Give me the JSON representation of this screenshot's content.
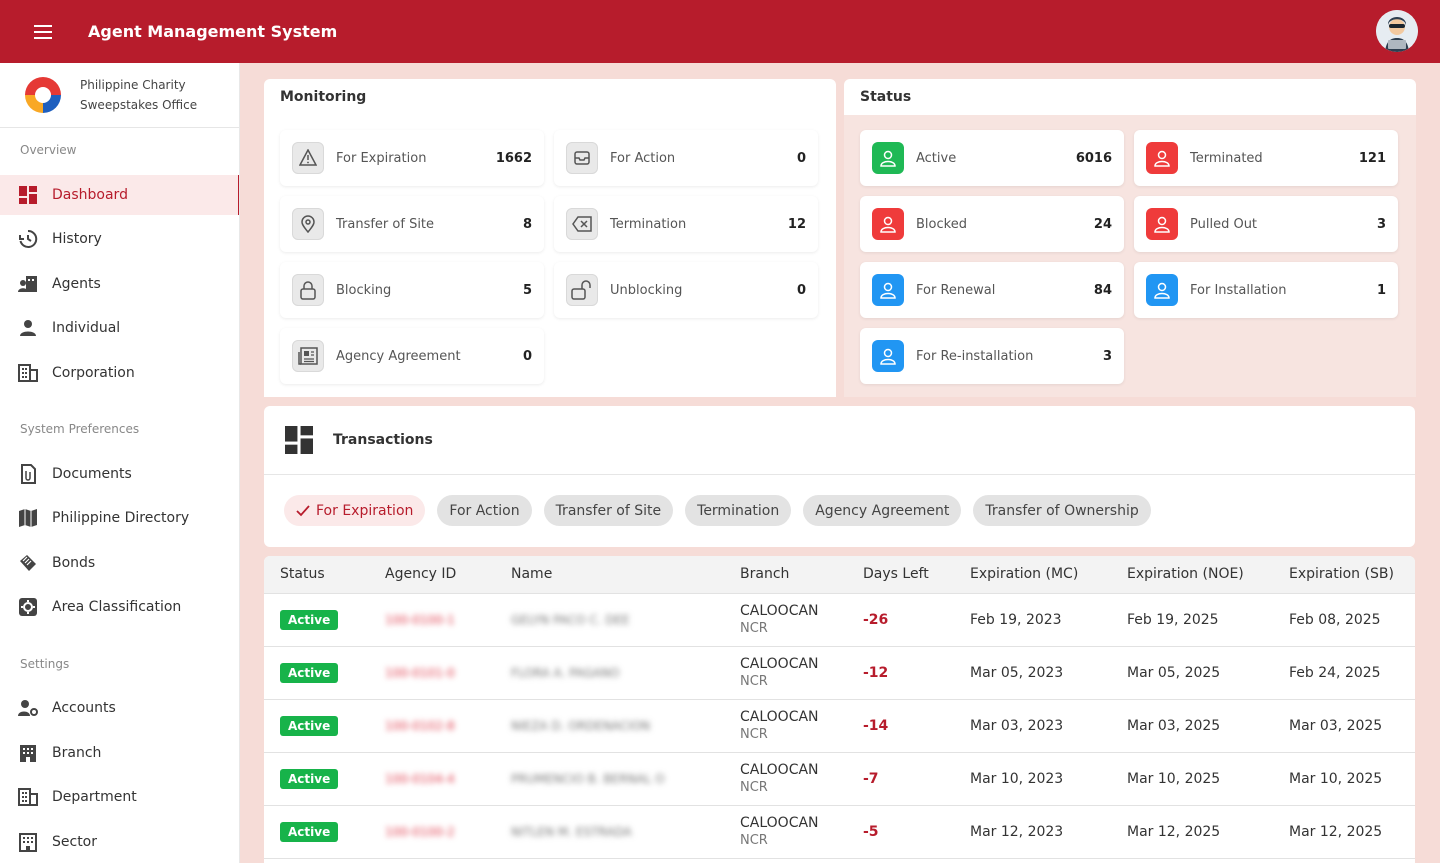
{
  "app": {
    "title": "Agent Management System"
  },
  "org": {
    "name_line1": "Philippine Charity",
    "name_line2": "Sweepstakes Office"
  },
  "sidebar": {
    "sections": {
      "overview": "Overview",
      "preferences": "System Preferences",
      "settings": "Settings"
    },
    "items": [
      {
        "label": "Dashboard",
        "icon": "dashboard-icon",
        "active": true
      },
      {
        "label": "History",
        "icon": "history-icon"
      },
      {
        "label": "Agents",
        "icon": "agents-icon"
      },
      {
        "label": "Individual",
        "icon": "person-icon"
      },
      {
        "label": "Corporation",
        "icon": "building-icon"
      },
      {
        "label": "Documents",
        "icon": "documents-icon"
      },
      {
        "label": "Philippine Directory",
        "icon": "map-icon"
      },
      {
        "label": "Bonds",
        "icon": "bonds-icon"
      },
      {
        "label": "Area Classification",
        "icon": "gear-icon"
      },
      {
        "label": "Accounts",
        "icon": "accounts-icon"
      },
      {
        "label": "Branch",
        "icon": "branch-icon"
      },
      {
        "label": "Department",
        "icon": "department-icon"
      },
      {
        "label": "Sector",
        "icon": "sector-icon"
      }
    ]
  },
  "monitoring": {
    "title": "Monitoring",
    "tiles": [
      {
        "label": "For Expiration",
        "count": "1662",
        "icon": "warning-icon"
      },
      {
        "label": "For Action",
        "count": "0",
        "icon": "inbox-icon"
      },
      {
        "label": "Transfer of Site",
        "count": "8",
        "icon": "location-pin-icon"
      },
      {
        "label": "Termination",
        "count": "12",
        "icon": "backspace-icon"
      },
      {
        "label": "Blocking",
        "count": "5",
        "icon": "lock-icon"
      },
      {
        "label": "Unblocking",
        "count": "0",
        "icon": "unlock-icon"
      },
      {
        "label": "Agency Agreement",
        "count": "0",
        "icon": "newspaper-icon"
      }
    ]
  },
  "status": {
    "title": "Status",
    "tiles": [
      {
        "label": "Active",
        "count": "6016",
        "color": "#1fb955"
      },
      {
        "label": "Terminated",
        "count": "121",
        "color": "#ef3b3b"
      },
      {
        "label": "Blocked",
        "count": "24",
        "color": "#ef3b3b"
      },
      {
        "label": "Pulled Out",
        "count": "3",
        "color": "#ef3b3b"
      },
      {
        "label": "For Renewal",
        "count": "84",
        "color": "#2196f3"
      },
      {
        "label": "For Installation",
        "count": "1",
        "color": "#2196f3"
      },
      {
        "label": "For Re-installation",
        "count": "3",
        "color": "#2196f3"
      }
    ]
  },
  "transactions": {
    "title": "Transactions",
    "chips": [
      {
        "label": "For Expiration",
        "selected": true
      },
      {
        "label": "For Action"
      },
      {
        "label": "Transfer of Site"
      },
      {
        "label": "Termination"
      },
      {
        "label": "Agency Agreement"
      },
      {
        "label": "Transfer of Ownership"
      }
    ]
  },
  "table": {
    "headers": [
      "Status",
      "Agency ID",
      "Name",
      "Branch",
      "Days Left",
      "Expiration (MC)",
      "Expiration (NOE)",
      "Expiration (SB)"
    ],
    "rows": [
      {
        "status": "Active",
        "agency_id": "100-0100-1",
        "name": "GELYN PACO C. DEE",
        "branch": "CALOOCAN",
        "region": "NCR",
        "days": "-26",
        "mc": "Feb 19, 2023",
        "noe": "Feb 19, 2025",
        "sb": "Feb 08, 2025"
      },
      {
        "status": "Active",
        "agency_id": "100-0101-0",
        "name": "FLORA A. PAGANO",
        "branch": "CALOOCAN",
        "region": "NCR",
        "days": "-12",
        "mc": "Mar 05, 2023",
        "noe": "Mar 05, 2025",
        "sb": "Feb 24, 2025"
      },
      {
        "status": "Active",
        "agency_id": "100-0102-8",
        "name": "NIEZA D. ORDENACION",
        "branch": "CALOOCAN",
        "region": "NCR",
        "days": "-14",
        "mc": "Mar 03, 2023",
        "noe": "Mar 03, 2025",
        "sb": "Mar 03, 2025"
      },
      {
        "status": "Active",
        "agency_id": "100-0104-4",
        "name": "PRUMENCIO B. BERNAL O",
        "branch": "CALOOCAN",
        "region": "NCR",
        "days": "-7",
        "mc": "Mar 10, 2023",
        "noe": "Mar 10, 2025",
        "sb": "Mar 10, 2025"
      },
      {
        "status": "Active",
        "agency_id": "100-0100-2",
        "name": "NITLEN M. ESTRADA",
        "branch": "CALOOCAN",
        "region": "NCR",
        "days": "-5",
        "mc": "Mar 12, 2023",
        "noe": "Mar 12, 2025",
        "sb": "Mar 12, 2025"
      }
    ]
  }
}
